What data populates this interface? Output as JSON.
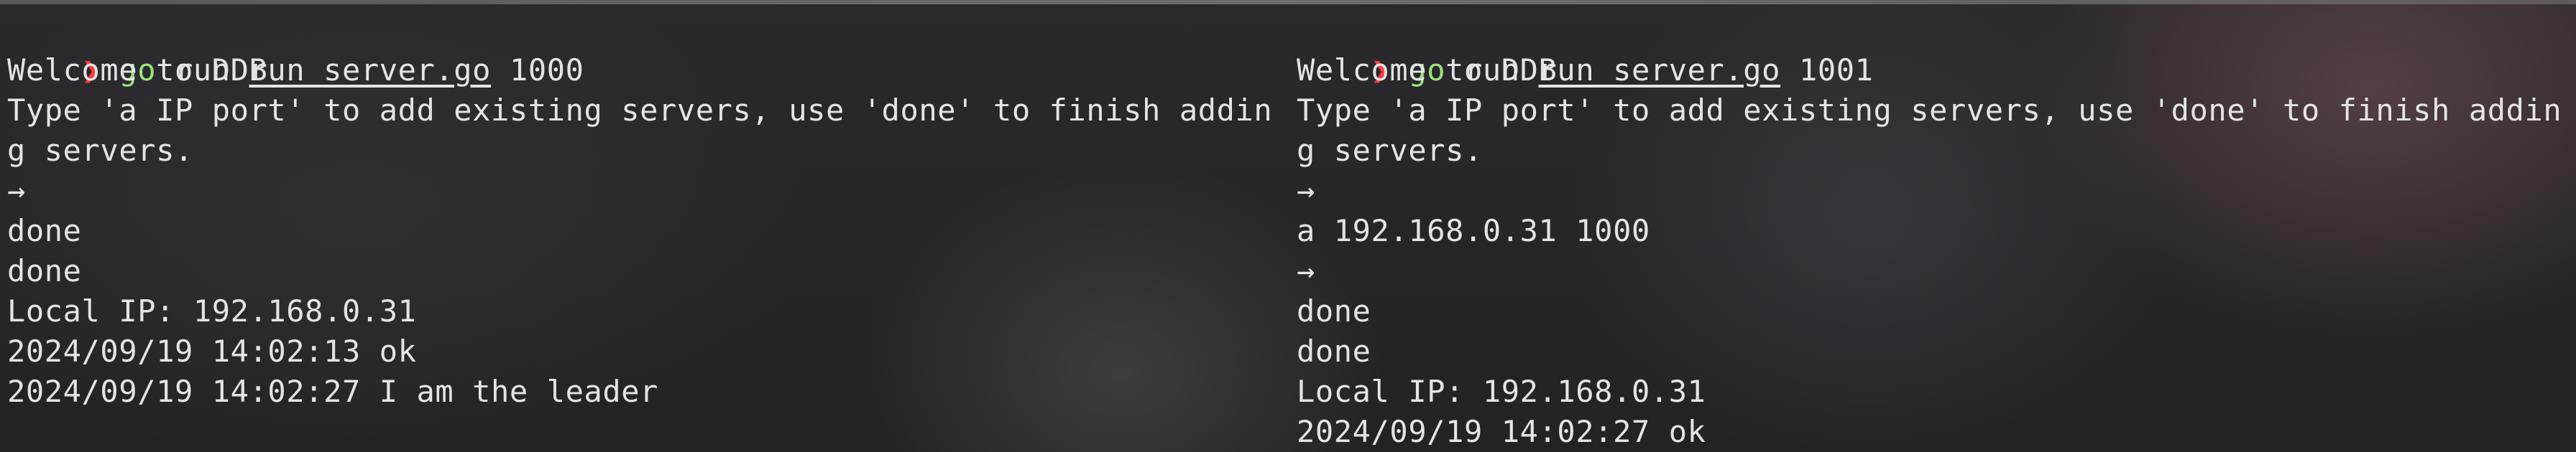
{
  "left_terminal": {
    "prompt_symbol": "❯",
    "command_verb": "go",
    "command_rest_before": " run ",
    "command_file": "run_server.go",
    "command_arg": " 1000",
    "lines": [
      "Welcome to DDB",
      "Type 'a IP port' to add existing servers, use 'done' to finish addin",
      "g servers.",
      "→",
      "done",
      "done",
      "Local IP: 192.168.0.31",
      "2024/09/19 14:02:13 ok",
      "2024/09/19 14:02:27 I am the leader"
    ]
  },
  "right_terminal": {
    "prompt_symbol": "❯",
    "command_verb": "go",
    "command_rest_before": " run ",
    "command_file": "run_server.go",
    "command_arg": " 1001",
    "lines": [
      "Welcome to DDB",
      "Type 'a IP port' to add existing servers, use 'done' to finish addin",
      "g servers.",
      "→",
      "a 192.168.0.31 1000",
      "→",
      "done",
      "done",
      "Local IP: 192.168.0.31",
      "2024/09/19 14:02:27 ok"
    ]
  },
  "colors": {
    "prompt": "#ff3b3b",
    "command": "#9be37a",
    "text": "#e4e4e6",
    "background": "#262628"
  }
}
